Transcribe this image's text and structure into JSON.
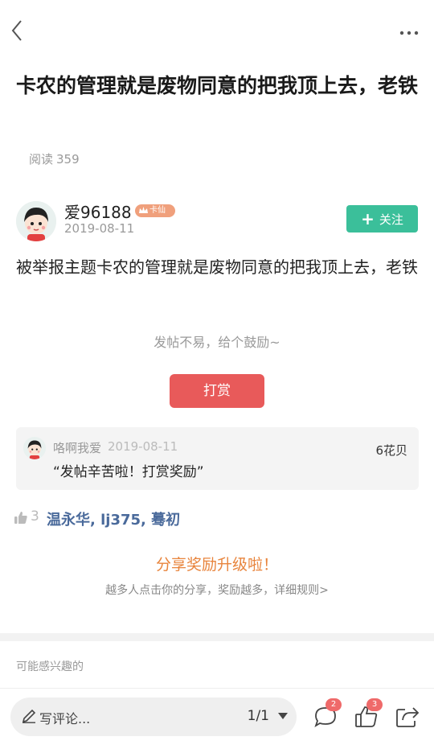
{
  "colors": {
    "accent_green": "#3bbf9a",
    "reward_red": "#e85a5a",
    "share_orange": "#e8843c",
    "liker_blue": "#4a6a9b",
    "badge_orange": "#f0a07c"
  },
  "topbar": {
    "back_icon": "chevron-left-icon",
    "more_icon": "more-dots-icon"
  },
  "post": {
    "title": "卡农的管理就是废物同意的把我顶上去，老铁",
    "reads_label": "阅读",
    "reads_count": "359",
    "author": {
      "name": "爱96188",
      "badge": "卡仙",
      "date": "2019-08-11",
      "follow_label": "关注"
    },
    "content": "被举报主题卡农的管理就是废物同意的把我顶上去，老铁",
    "encourage_text": "发帖不易，给个鼓励~",
    "reward_button": "打赏"
  },
  "reward_record": {
    "name": "咯啊我爱",
    "date": "2019-08-11",
    "amount": "6花贝",
    "message": "“发帖辛苦啦！打赏奖励”"
  },
  "likes": {
    "count": "3",
    "users": "温永华, lj375, 蓦初"
  },
  "share": {
    "title": "分享奖励升级啦！",
    "subtitle": "越多人点击你的分享，奖励越多，详细规则>"
  },
  "interest_label": "可能感兴趣的",
  "bottombar": {
    "comment_placeholder": "写评论...",
    "pager": "1/1",
    "comment_badge": "2",
    "like_badge": "3"
  }
}
